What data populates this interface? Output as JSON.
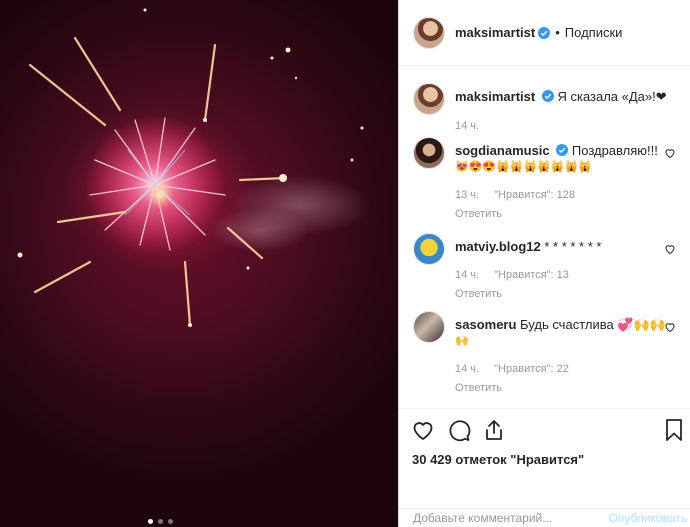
{
  "post": {
    "author": "maksimartist",
    "follow_state": "Подписки",
    "separator": "•"
  },
  "caption": {
    "username": "maksimartist",
    "text": "Я сказала «Да»!❤",
    "time": "14 ч."
  },
  "comments": [
    {
      "username": "sogdianamusic",
      "text": "Поздравляю!!!",
      "emoji_line": "😻😍😍🙀🙀🙀🙀🙀🙀🙀",
      "time": "13 ч.",
      "likes": "\"Нравится\": 128",
      "reply": "Ответить"
    },
    {
      "username": "matviy.blog12",
      "text": "* * * * * * *",
      "time": "14 ч.",
      "likes": "\"Нравится\": 13",
      "reply": "Ответить"
    },
    {
      "username": "sasomeru",
      "text": "Будь счастлива 💞🙌🙌",
      "emoji_line": "🙌",
      "time": "14 ч.",
      "likes": "\"Нравится\": 22",
      "reply": "Ответить"
    }
  ],
  "likes_text": "30 429 отметок \"Нравится\"",
  "add_comment": {
    "placeholder": "Добавьте комментарий...",
    "publish_label": "Опубликовать"
  },
  "carousel": {
    "count": 3,
    "active": 1
  },
  "colors": {
    "verified": "#3897f0",
    "publish_disabled": "#b2dffc",
    "meta": "#999999"
  },
  "icons": [
    "verified-badge-icon",
    "heart-icon",
    "comment-icon",
    "share-icon",
    "bookmark-icon"
  ]
}
